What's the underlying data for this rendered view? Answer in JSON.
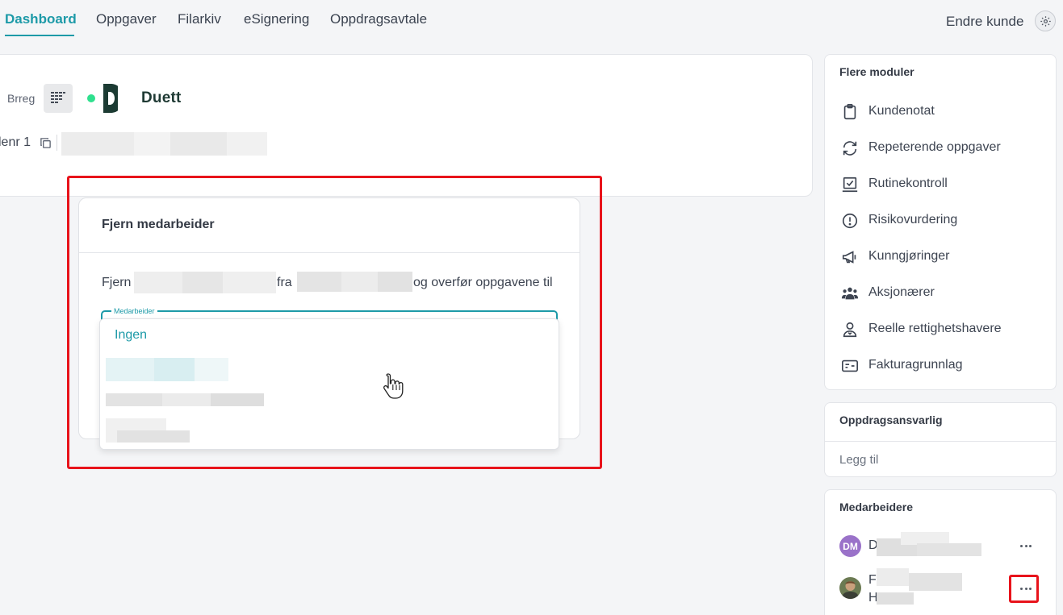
{
  "topnav": {
    "tabs": [
      {
        "label": "Dashboard",
        "active": true
      },
      {
        "label": "Oppgaver"
      },
      {
        "label": "Filarkiv"
      },
      {
        "label": "eSignering"
      },
      {
        "label": "Oppdragsavtale"
      }
    ],
    "change_customer": "Endre kunde",
    "settings_icon": "gear-icon"
  },
  "customer": {
    "brreg_label": "Brreg",
    "integration_name": "Duett",
    "orgnr_label": "lenr 1"
  },
  "dialog": {
    "title": "Fjern medarbeider",
    "text_prefix": "Fjern",
    "text_middle": "fra",
    "text_suffix": "og overfør oppgavene til",
    "field_label": "Medarbeider",
    "options": [
      "Ingen"
    ]
  },
  "modules": {
    "title": "Flere moduler",
    "items": [
      {
        "label": "Kundenotat",
        "icon": "clipboard-icon"
      },
      {
        "label": "Repeterende oppgaver",
        "icon": "refresh-icon"
      },
      {
        "label": "Rutinekontroll",
        "icon": "checklist-icon"
      },
      {
        "label": "Risikovurdering",
        "icon": "alert-circle-icon"
      },
      {
        "label": "Kunngjøringer",
        "icon": "megaphone-icon"
      },
      {
        "label": "Aksjonærer",
        "icon": "people-icon"
      },
      {
        "label": "Reelle rettighetshavere",
        "icon": "person-badge-icon"
      },
      {
        "label": "Fakturagrunnlag",
        "icon": "invoice-card-icon"
      }
    ]
  },
  "assignment": {
    "title": "Oppdragsansvarlig",
    "add_label": "Legg til"
  },
  "employees": {
    "title": "Medarbeidere",
    "list": [
      {
        "initials": "DM",
        "first_letter": "D",
        "avatar_color": "#9a72c9"
      },
      {
        "first_letter": "F",
        "second_letter": "H"
      }
    ]
  },
  "colors": {
    "accent": "#1d9aa8",
    "highlight": "#e8131b"
  }
}
